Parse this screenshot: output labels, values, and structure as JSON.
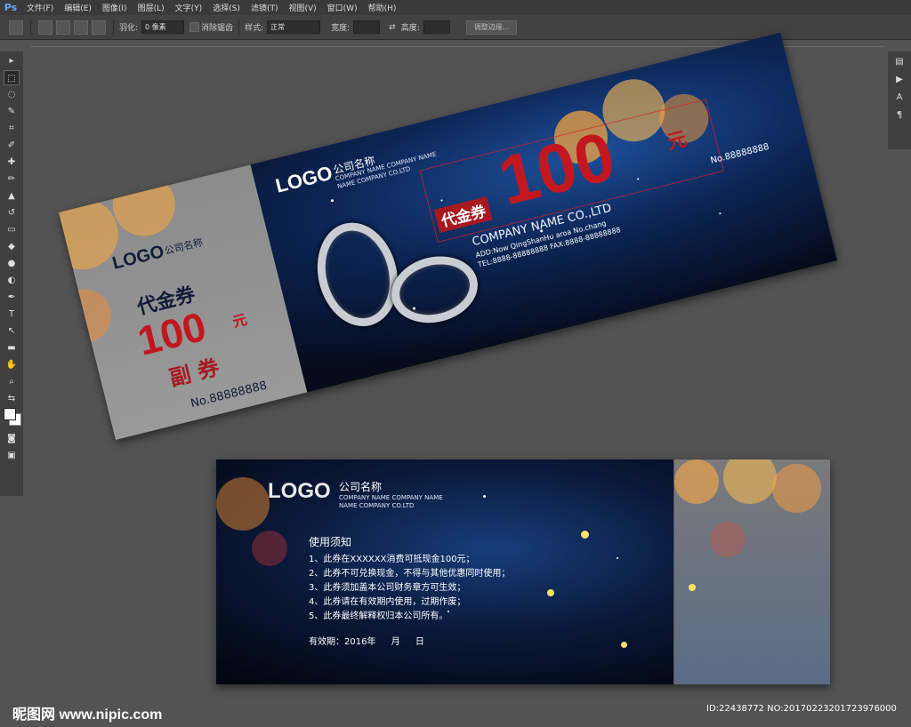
{
  "app": {
    "logo": "Ps"
  },
  "menu": [
    "文件(F)",
    "编辑(E)",
    "图像(I)",
    "图层(L)",
    "文字(Y)",
    "选择(S)",
    "滤镜(T)",
    "视图(V)",
    "窗口(W)",
    "帮助(H)"
  ],
  "options": {
    "feather_label": "羽化:",
    "feather_value": "0 像素",
    "antialias_label": "消除锯齿",
    "style_label": "样式:",
    "style_value": "正常",
    "width_label": "宽度:",
    "height_label": "高度:",
    "refine_button": "调整边缘..."
  },
  "coupon_front": {
    "logo": "LOGO",
    "company_cn": "公司名称",
    "company_en_line1": "COMPANY NAME COMPANY NAME",
    "company_en_line2": "NAME COMPANY CO.LTD",
    "tag": "代金券",
    "amount": "100",
    "unit": "元",
    "company_name": "COMPANY NAME CO.,LTD",
    "address": "ADD:Now QingShanHu aroa No.chang",
    "phones": "TEL:8888-88888888  FAX:8888-88888888",
    "number": "No.88888888",
    "stub": {
      "logo": "LOGO",
      "company_cn": "公司名称",
      "title": "代金券",
      "amount": "100",
      "unit": "元",
      "subtitle": "副 券",
      "number": "No.88888888"
    }
  },
  "coupon_back": {
    "logo": "LOGO",
    "company_cn": "公司名称",
    "company_en_line1": "COMPANY NAME COMPANY NAME",
    "company_en_line2": "NAME COMPANY CO.LTD",
    "notice_title": "使用须知",
    "rules": [
      "1、此券在XXXXXX消费可抵现金100元；",
      "2、此券不可兑换现金，不得与其他优惠同时使用；",
      "3、此券须加盖本公司财务章方可生效；",
      "4、此券请在有效期内使用，过期作废；",
      "5、此券最终解释权归本公司所有。"
    ],
    "validity_label": "有效期：2016年",
    "validity_month": "月",
    "validity_day": "日"
  },
  "watermark": "昵图网 www.nipic.com",
  "image_id": "ID:22438772 NO:20170223201723976000"
}
